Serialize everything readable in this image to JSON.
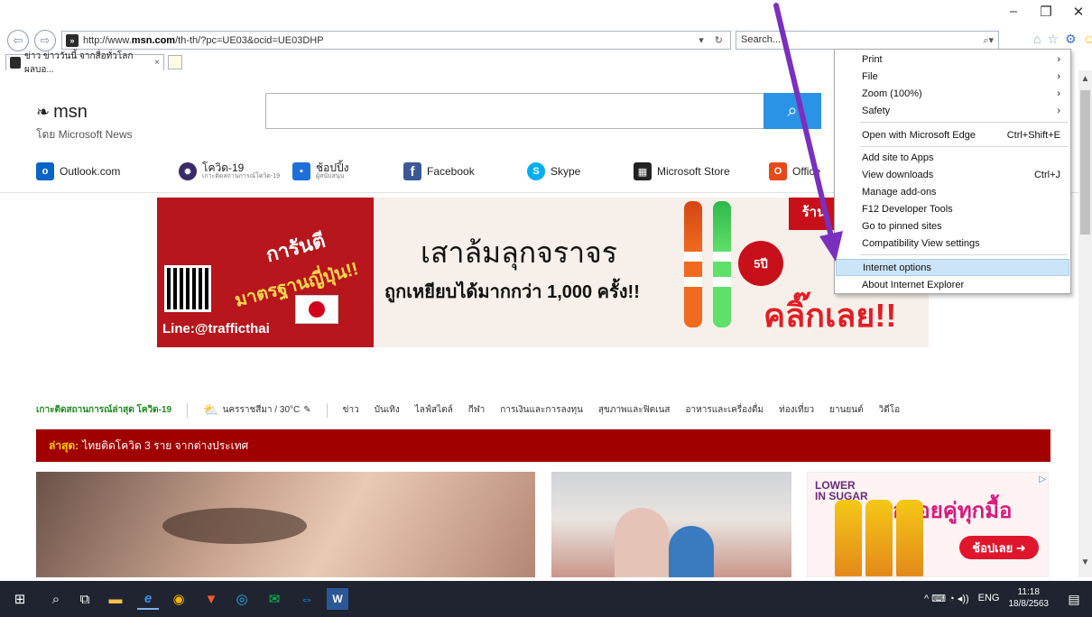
{
  "window": {
    "minimize": "–",
    "restore": "❐",
    "close": "✕"
  },
  "browser": {
    "back_icon": "⇦",
    "forward_icon": "⇨",
    "url_prefix": "http://www.",
    "url_domain": "msn.com",
    "url_path": "/th-th/?pc=UE03&ocid=UE03DHP",
    "dropdown_icon": "▾",
    "refresh_icon": "↻",
    "search_placeholder": "Search...",
    "search_icon": "⌕▾",
    "tab_title": "ข่าว ข่าววันนี้ จากสื่อทั่วโลก ผลบอ...",
    "tab_close": "×",
    "icons": {
      "home": "⌂",
      "favorites": "☆",
      "tools": "⚙",
      "feedback": "☺"
    }
  },
  "msn": {
    "logo_text": "msn",
    "byline": "โดย Microsoft News",
    "search_icon": "⌕"
  },
  "quicklinks": [
    {
      "label": "Outlook.com",
      "icon_text": "o",
      "color": "#0a64c8"
    },
    {
      "label": "โควิด-19",
      "sub": "เกาะติดสถานการณ์โควิด-19",
      "icon_text": "✹",
      "color": "#3a2a6a"
    },
    {
      "label": "ช้อปปิ้ง",
      "sub": "ผู้สนับสนุน",
      "icon_text": "▪",
      "color": "#1e6fd9"
    },
    {
      "label": "Facebook",
      "icon_text": "f",
      "color": "#3b5998"
    },
    {
      "label": "Skype",
      "icon_text": "S",
      "color": "#00aff0"
    },
    {
      "label": "Microsoft Store",
      "icon_text": "▦",
      "color": "#222222"
    },
    {
      "label": "Office",
      "icon_text": "O",
      "color": "#e64a19"
    }
  ],
  "banner": {
    "left_line1": "การันตี",
    "left_line2": "มาตรฐานญี่ปุ่น!!",
    "line_id": "Line:@trafficthai",
    "title": "เสาล้มลุกจราจร",
    "subtitle": "ถูกเหยียบได้มากกว่า 1,000 ครั้ง!!",
    "badge": "5ปี",
    "click": "คลิ๊กเลย!!",
    "shop": "ร้าน"
  },
  "newsnav": {
    "covid": "เกาะติดสถานการณ์ล่าสุด โควิด-19",
    "weather": "นครราชสีมา / 30°C",
    "edit_icon": "✎",
    "items": [
      "ข่าว",
      "บันเทิง",
      "ไลฟ์สไตล์",
      "กีฬา",
      "การเงินและการลงทุน",
      "สุขภาพและฟิตเนส",
      "อาหารและเครื่องดื่ม",
      "ท่องเที่ยว",
      "ยานยนต์",
      "วิดีโอ"
    ]
  },
  "breaking": {
    "label": "ล่าสุด:",
    "text": "ไทยติดโควิด 3 ราย จากต่างประเทศ"
  },
  "ad": {
    "lower": "LOWER",
    "insugar": "IN SUGAR",
    "headline": "อร่อยคู่ทุกมื้อ",
    "buy": "ช้อปเลย ➜",
    "adchoice": "▷"
  },
  "tools_menu": [
    {
      "label": "Print",
      "shortcut": "›"
    },
    {
      "label": "File",
      "shortcut": "›"
    },
    {
      "label": "Zoom (100%)",
      "shortcut": "›"
    },
    {
      "label": "Safety",
      "shortcut": "›"
    },
    {
      "label": "Open with Microsoft Edge",
      "shortcut": "Ctrl+Shift+E"
    },
    {
      "label": "Add site to Apps",
      "shortcut": ""
    },
    {
      "label": "View downloads",
      "shortcut": "Ctrl+J"
    },
    {
      "label": "Manage add-ons",
      "shortcut": ""
    },
    {
      "label": "F12 Developer Tools",
      "shortcut": ""
    },
    {
      "label": "Go to pinned sites",
      "shortcut": ""
    },
    {
      "label": "Compatibility View settings",
      "shortcut": ""
    },
    {
      "label": "Internet options",
      "shortcut": ""
    },
    {
      "label": "About Internet Explorer",
      "shortcut": ""
    }
  ],
  "taskbar": {
    "icons": [
      "⊞",
      "⌕",
      "⧉",
      "▬",
      "e",
      "◉",
      "▼",
      "◎",
      "✉",
      "⇔",
      "W"
    ],
    "tray": "^ ⌨ ◔ ◂))",
    "lang": "ENG",
    "time": "11:18",
    "date": "18/8/2563",
    "notification": "▤"
  },
  "colors": {
    "accent": "#2a93e6",
    "breaking_bg": "#a10000",
    "arrow": "#7b2fbf",
    "menu_highlight": "#cce4f7"
  }
}
